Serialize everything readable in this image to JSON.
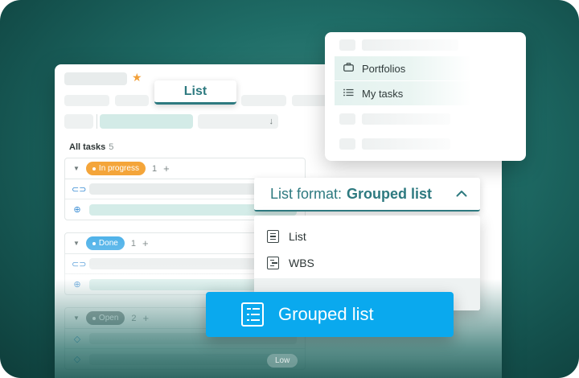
{
  "colors": {
    "accent": "#2e7a80",
    "in_progress": "#f4a53a",
    "done": "#4bb0e8",
    "open": "#7a8686",
    "selected": "#0aa9ee",
    "star": "#f2a03a"
  },
  "view_tab": {
    "label": "List"
  },
  "task_list": {
    "header_label": "All tasks",
    "header_count": "5",
    "sort_icon": "arrow-down-icon",
    "groups": [
      {
        "status": "In progress",
        "count": "1",
        "plus": "+"
      },
      {
        "status": "Done",
        "count": "1",
        "plus": "+"
      },
      {
        "status": "Open",
        "count": "2",
        "plus": "+"
      }
    ],
    "ghost_badge": "Low"
  },
  "nav_menu": {
    "items": [
      {
        "label": "Portfolios",
        "icon": "briefcase-icon"
      },
      {
        "label": "My tasks",
        "icon": "list-icon"
      }
    ]
  },
  "list_format": {
    "prefix": "List format:",
    "value": "Grouped list",
    "chevron": "^",
    "options": [
      {
        "label": "List",
        "icon": "list-doc-icon"
      },
      {
        "label": "WBS",
        "icon": "wbs-doc-icon"
      }
    ],
    "selected_option": {
      "label": "Grouped list",
      "icon": "grouped-list-icon"
    }
  }
}
